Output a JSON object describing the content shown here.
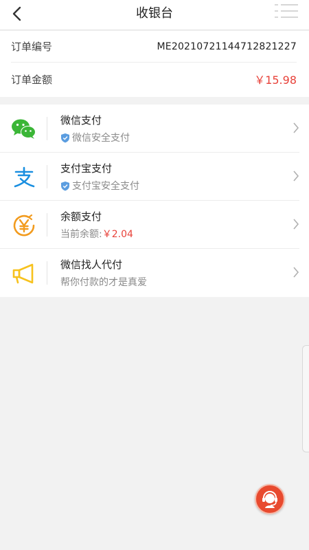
{
  "header": {
    "title": "收银台"
  },
  "order": {
    "number_label": "订单编号",
    "number_value": "ME20210721144712821227",
    "amount_label": "订单金额",
    "amount_value": "￥15.98"
  },
  "payments": [
    {
      "name": "微信支付",
      "sub": "微信安全支付",
      "icon": "wechat-icon"
    },
    {
      "name": "支付宝支付",
      "sub": "支付宝安全支付",
      "icon": "alipay-icon"
    },
    {
      "name": "余额支付",
      "sub_prefix": "当前余额:",
      "sub_amount": "￥2.04",
      "icon": "yuan-coin-icon"
    },
    {
      "name": "微信找人代付",
      "sub": "帮你付款的才是真爱",
      "icon": "megaphone-icon"
    }
  ],
  "colors": {
    "accent_red": "#e8423a",
    "wechat_green": "#3bb637",
    "alipay_blue": "#1a8fe0",
    "balance_orange": "#f29b1e",
    "megaphone_yellow": "#f7c21d"
  }
}
